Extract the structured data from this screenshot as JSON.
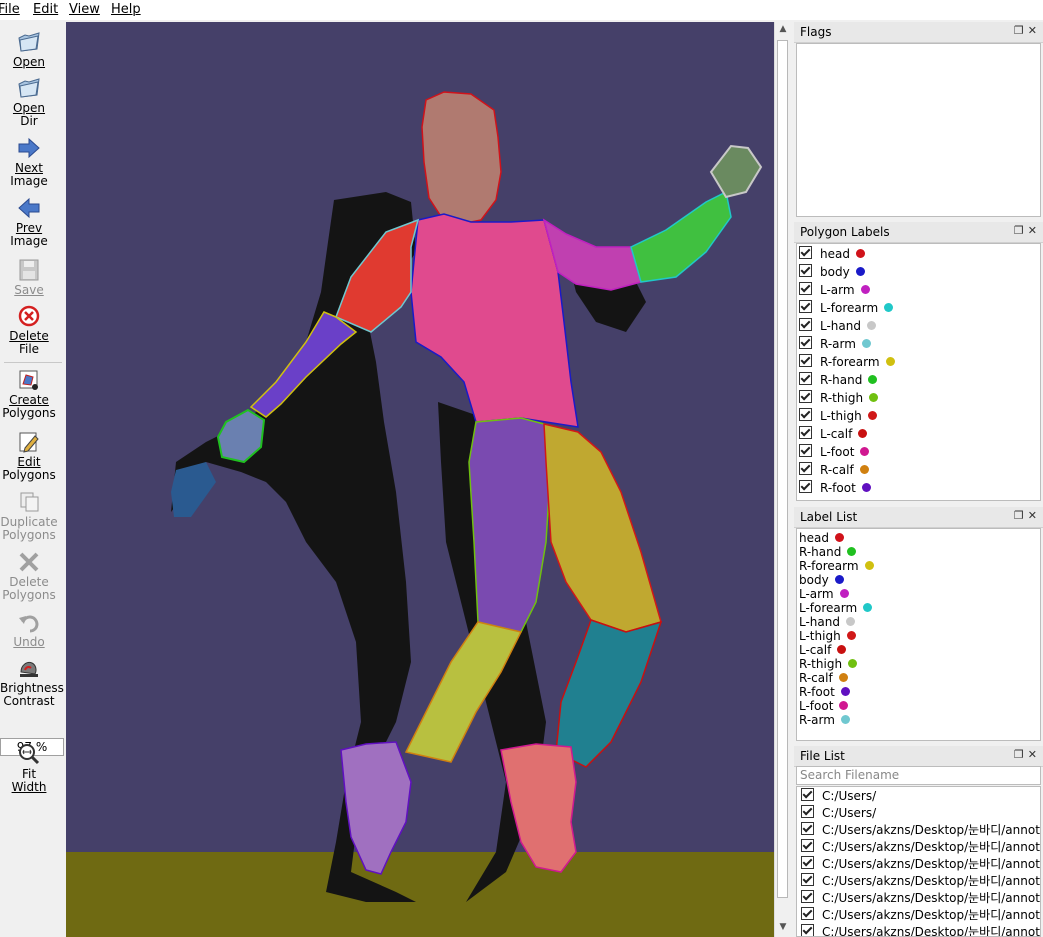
{
  "menu": [
    "File",
    "Edit",
    "View",
    "Help"
  ],
  "toolbar": {
    "open": "Open",
    "open_dir": [
      "Open",
      "Dir"
    ],
    "next_image": [
      "Next",
      "Image"
    ],
    "prev_image": [
      "Prev",
      "Image"
    ],
    "save": "Save",
    "delete_file": [
      "Delete",
      "File"
    ],
    "create_polygons": [
      "Create",
      "Polygons"
    ],
    "edit_polygons": [
      "Edit",
      "Polygons"
    ],
    "duplicate_polygons": [
      "Duplicate",
      "Polygons"
    ],
    "delete_polygons": [
      "Delete",
      "Polygons"
    ],
    "undo": "Undo",
    "brightness_contrast": [
      "Brightness",
      "Contrast"
    ],
    "zoom": "97 %",
    "fit_width": [
      "Fit",
      "Width"
    ]
  },
  "flags": {
    "title": "Flags"
  },
  "polygon_labels": {
    "title": "Polygon Labels",
    "items": [
      {
        "label": "head",
        "color": "#d0121a"
      },
      {
        "label": "body",
        "color": "#1a1ac8"
      },
      {
        "label": "L-arm",
        "color": "#c020c0"
      },
      {
        "label": "L-forearm",
        "color": "#20c8c8"
      },
      {
        "label": "L-hand",
        "color": "#c8c8c8"
      },
      {
        "label": "R-arm",
        "color": "#70c8d0"
      },
      {
        "label": "R-forearm",
        "color": "#d0c010"
      },
      {
        "label": "R-hand",
        "color": "#20c020"
      },
      {
        "label": "R-thigh",
        "color": "#70c010"
      },
      {
        "label": "L-thigh",
        "color": "#d01818"
      },
      {
        "label": "L-calf",
        "color": "#c81010"
      },
      {
        "label": "L-foot",
        "color": "#d01890"
      },
      {
        "label": "R-calf",
        "color": "#d08010"
      },
      {
        "label": "R-foot",
        "color": "#6010c0"
      }
    ]
  },
  "label_list": {
    "title": "Label List",
    "items": [
      {
        "label": "head",
        "color": "#d0121a"
      },
      {
        "label": "R-hand",
        "color": "#20c020"
      },
      {
        "label": "R-forearm",
        "color": "#d0c010"
      },
      {
        "label": "body",
        "color": "#1a1ac8"
      },
      {
        "label": "L-arm",
        "color": "#c020c0"
      },
      {
        "label": "L-forearm",
        "color": "#20c8c8"
      },
      {
        "label": "L-hand",
        "color": "#c8c8c8"
      },
      {
        "label": "L-thigh",
        "color": "#d01818"
      },
      {
        "label": "L-calf",
        "color": "#c81010"
      },
      {
        "label": "R-thigh",
        "color": "#70c010"
      },
      {
        "label": "R-calf",
        "color": "#d08010"
      },
      {
        "label": "R-foot",
        "color": "#6010c0"
      },
      {
        "label": "L-foot",
        "color": "#d01890"
      },
      {
        "label": "R-arm",
        "color": "#70c8d0"
      }
    ]
  },
  "file_list": {
    "title": "File List",
    "search_placeholder": "Search Filename",
    "items": [
      "C:/Users/",
      "C:/Users/",
      "C:/Users/akzns/Desktop/눈바디/annotat",
      "C:/Users/akzns/Desktop/눈바디/annotat",
      "C:/Users/akzns/Desktop/눈바디/annotat",
      "C:/Users/akzns/Desktop/눈바디/annotat",
      "C:/Users/akzns/Desktop/눈바디/annotat",
      "C:/Users/akzns/Desktop/눈바디/annotat",
      "C:/Users/akzns/Desktop/눈바디/annotat"
    ]
  },
  "colors": {
    "canvas_bg": "#454069",
    "floor": "#6f6a12"
  }
}
